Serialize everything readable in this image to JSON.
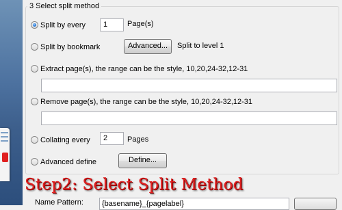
{
  "group": {
    "title": "3 Select split method"
  },
  "options": {
    "split_every": {
      "label": "Split by every",
      "value": "1",
      "unit": "Page(s)",
      "selected": true
    },
    "split_bookmark": {
      "label": "Split by bookmark",
      "button_label": "Advanced...",
      "level_text": "Split to level 1",
      "selected": false
    },
    "extract": {
      "label": "Extract page(s), the range can be the style, 10,20,24-32,12-31",
      "value": "",
      "selected": false
    },
    "remove": {
      "label": "Remove page(s), the range can be the style, 10,20,24-32,12-31",
      "value": "",
      "selected": false
    },
    "collating": {
      "label": "Collating every",
      "value": "2",
      "unit": "Pages",
      "selected": false
    },
    "advanced_define": {
      "label": "Advanced define",
      "button_label": "Define...",
      "selected": false
    }
  },
  "caption": "Step2: Select Split Method",
  "name_pattern": {
    "label": "Name Pattern:",
    "value": "{basename}_{pagelabel}"
  },
  "colors": {
    "caption": "#e02020",
    "background": "#f0f0f0",
    "radio_selected": "#2b7bd8"
  }
}
